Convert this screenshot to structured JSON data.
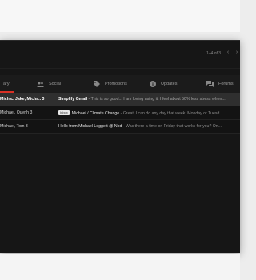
{
  "toolbar": {
    "pager_text": "1–4 of 3"
  },
  "tabs": [
    {
      "label": "ary",
      "icon": "inbox-icon",
      "active": true
    },
    {
      "label": "Social",
      "icon": "people-icon"
    },
    {
      "label": "Promotions",
      "icon": "tag-icon"
    },
    {
      "label": "Updates",
      "icon": "info-icon"
    },
    {
      "label": "Forums",
      "icon": "forum-icon"
    }
  ],
  "emails": [
    {
      "sender": "Micha.. Jake, Micha.. 3",
      "subject": "Simplify Gmail",
      "snippet": " - This is so good... I am loving using it. I feel about 50% less stress when...",
      "unread": true
    },
    {
      "sender": "Michael, Quynh 3",
      "badge": "Inbox",
      "subject": "Michael / Climate Change",
      "snippet": " - Great. I can do any day that week. Monday or Tuesd...",
      "unread": false
    },
    {
      "sender": "Michael, Tom 3",
      "subject": "Hello from Michael Leggett @ Nod",
      "snippet": " - Was there a time on Friday that works for you? On...",
      "unread": false
    }
  ]
}
